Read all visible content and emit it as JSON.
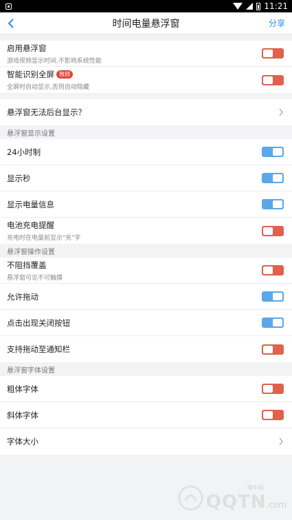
{
  "status_bar": {
    "time": "11:21"
  },
  "header": {
    "title": "时间电量悬浮窗",
    "share": "分享"
  },
  "group1": [
    {
      "title": "启用悬浮窗",
      "sub": "游戏视频显示时间,不影响系统性能",
      "state": "off"
    },
    {
      "title": "智能识别全屏",
      "badge": "独创",
      "sub": "全屏时自动显示,否则自动隐藏",
      "state": "off"
    }
  ],
  "help_row": {
    "title": "悬浮窗无法后台显示？"
  },
  "section_display": {
    "title": "悬浮窗显示设置",
    "items": [
      {
        "title": "24小时制",
        "state": "on"
      },
      {
        "title": "显示秒",
        "state": "on"
      },
      {
        "title": "显示电量信息",
        "state": "on"
      },
      {
        "title": "电池充电提醒",
        "sub": "充电时在电量前显示\"充\"字",
        "state": "off"
      }
    ]
  },
  "section_operation": {
    "title": "悬浮窗操作设置",
    "items": [
      {
        "title": "不阻挡覆盖",
        "sub": "悬浮窗可见不可触摸",
        "state": "off"
      },
      {
        "title": "允许拖动",
        "state": "on"
      },
      {
        "title": "点击出现关闭按钮",
        "state": "on"
      },
      {
        "title": "支持拖动至通知栏",
        "state": "off"
      }
    ]
  },
  "section_font": {
    "title": "悬浮窗字体设置",
    "items": [
      {
        "title": "粗体字体",
        "state": "off"
      },
      {
        "title": "斜体字体",
        "state": "off"
      }
    ],
    "font_size": {
      "title": "字体大小"
    }
  },
  "watermark": {
    "small": "腾牛网",
    "big": "QQTN",
    "com": ".com"
  },
  "colors": {
    "toggle_on": "#5aa7ea",
    "toggle_off": "#e0624c",
    "accent": "#2a8ce8"
  }
}
